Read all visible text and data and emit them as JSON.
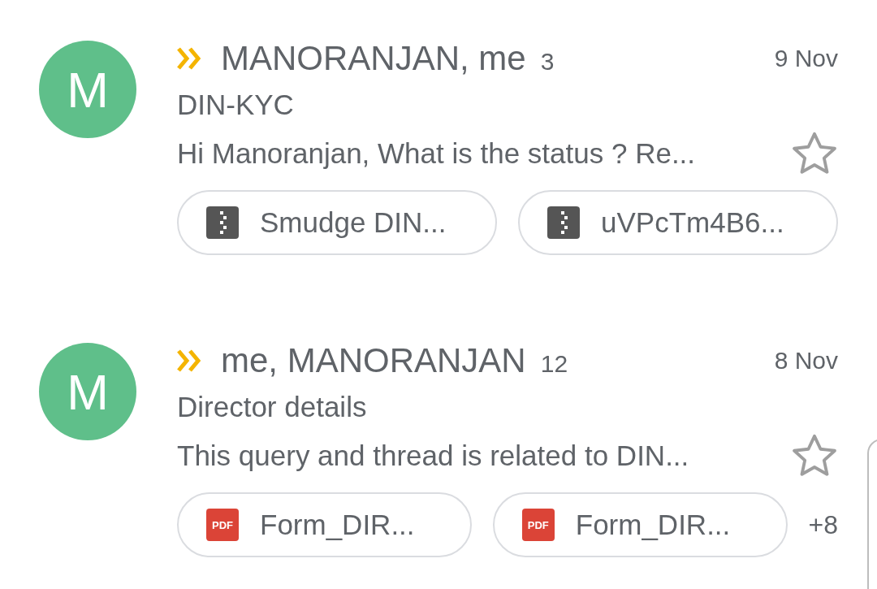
{
  "threads": [
    {
      "avatar_letter": "M",
      "important": true,
      "senders": "MANORANJAN, me",
      "count": "3",
      "date": "9 Nov",
      "subject": "DIN-KYC",
      "snippet": "Hi Manoranjan, What is the status ? Re...",
      "starred": false,
      "attachments": [
        {
          "kind": "zip",
          "name": "Smudge DIN..."
        },
        {
          "kind": "zip",
          "name": "uVPcTm4B6..."
        }
      ]
    },
    {
      "avatar_letter": "M",
      "important": true,
      "senders": "me, MANORANJAN",
      "count": "12",
      "date": "8 Nov",
      "subject": "Director details",
      "snippet": "This query and thread is related to DIN...",
      "starred": false,
      "attachments": [
        {
          "kind": "pdf",
          "icon_text": "PDF",
          "name": "Form_DIR..."
        },
        {
          "kind": "pdf",
          "icon_text": "PDF",
          "name": "Form_DIR..."
        }
      ],
      "more": "+8"
    }
  ]
}
